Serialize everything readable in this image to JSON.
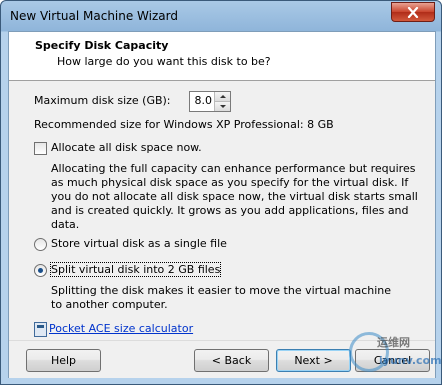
{
  "window": {
    "title": "New Virtual Machine Wizard"
  },
  "header": {
    "title": "Specify Disk Capacity",
    "subtitle": "How large do you want this disk to be?"
  },
  "disk_size": {
    "label": "Maximum disk size (GB):",
    "value": "8.0",
    "recommended": "Recommended size for Windows XP Professional: 8 GB"
  },
  "allocate": {
    "label": "Allocate all disk space now.",
    "checked": false,
    "description": "Allocating the full capacity can enhance performance but requires as much physical disk space as you specify for the virtual disk. If you do not allocate all disk space now, the virtual disk starts small and is created quickly. It grows as you add applications, files and data."
  },
  "storage": {
    "single_label": "Store virtual disk as a single file",
    "split_label": "Split virtual disk into 2 GB files",
    "selected": "split",
    "split_description": "Splitting the disk makes it easier to move the virtual machine to another computer."
  },
  "link": {
    "label": "Pocket ACE size calculator"
  },
  "buttons": {
    "help": "Help",
    "back": "< Back",
    "next": "Next >",
    "cancel": "Cancel"
  },
  "watermark": {
    "text": "运维网",
    "sub": "iyunv.com"
  }
}
